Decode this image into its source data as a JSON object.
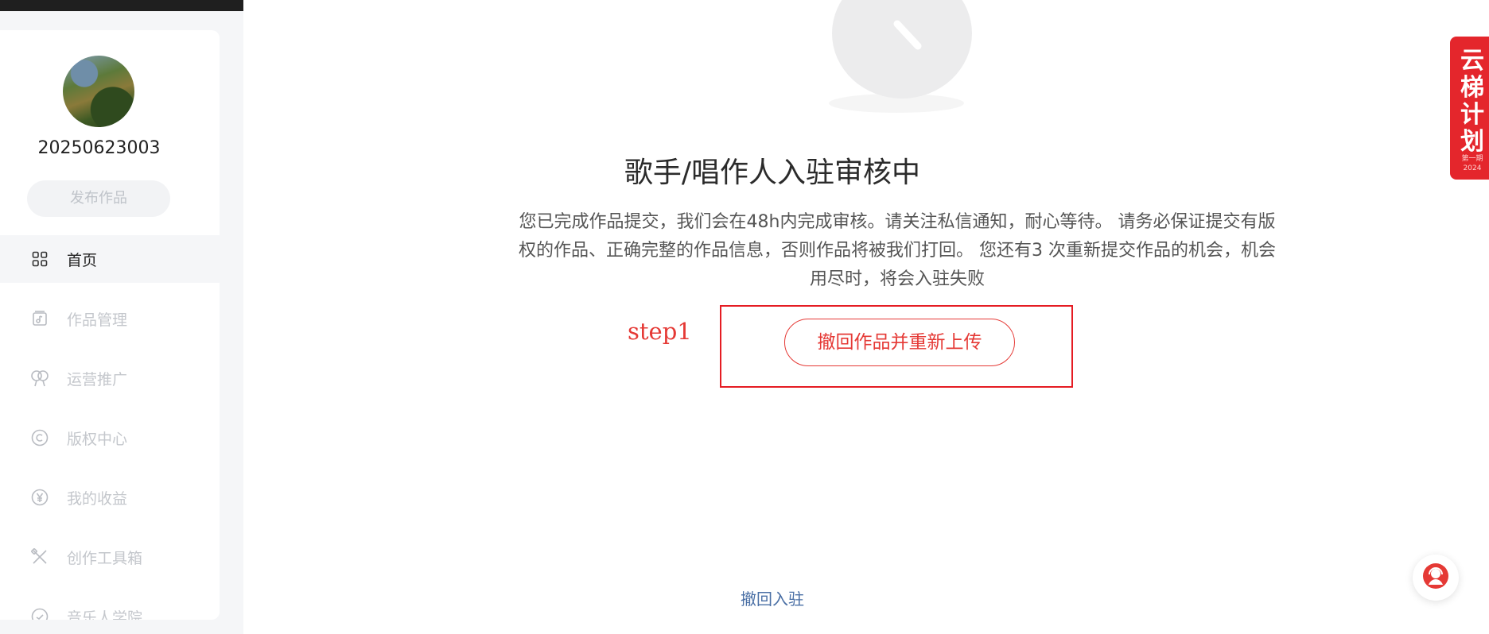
{
  "user": {
    "username": "20250623003",
    "publish_label": "发布作品"
  },
  "sidebar": {
    "items": [
      {
        "label": "首页",
        "icon": "grid-icon",
        "active": true
      },
      {
        "label": "作品管理",
        "icon": "music-doc-icon",
        "active": false
      },
      {
        "label": "运营推广",
        "icon": "balloon-icon",
        "active": false
      },
      {
        "label": "版权中心",
        "icon": "copyright-icon",
        "active": false
      },
      {
        "label": "我的收益",
        "icon": "yen-icon",
        "active": false
      },
      {
        "label": "创作工具箱",
        "icon": "tools-icon",
        "active": false
      },
      {
        "label": "音乐人学院",
        "icon": "academy-icon",
        "active": false
      }
    ]
  },
  "main": {
    "title": "歌手/唱作人入驻审核中",
    "description": "您已完成作品提交，我们会在48h内完成审核。请关注私信通知，耐心等待。 请务必保证提交有版权的作品、正确完整的作品信息，否则作品将被我们打回。 您还有3 次重新提交作品的机会，机会用尽时，将会入驻失败",
    "step_label": "step1",
    "withdraw_button_label": "撤回作品并重新上传",
    "withdraw_link_label": "撤回入驻"
  },
  "banner": {
    "text": "云梯计划",
    "sub_text": "第一期\n2024"
  },
  "colors": {
    "accent": "#e53935",
    "link": "#4a6fa5",
    "annotation": "#e51c23"
  }
}
